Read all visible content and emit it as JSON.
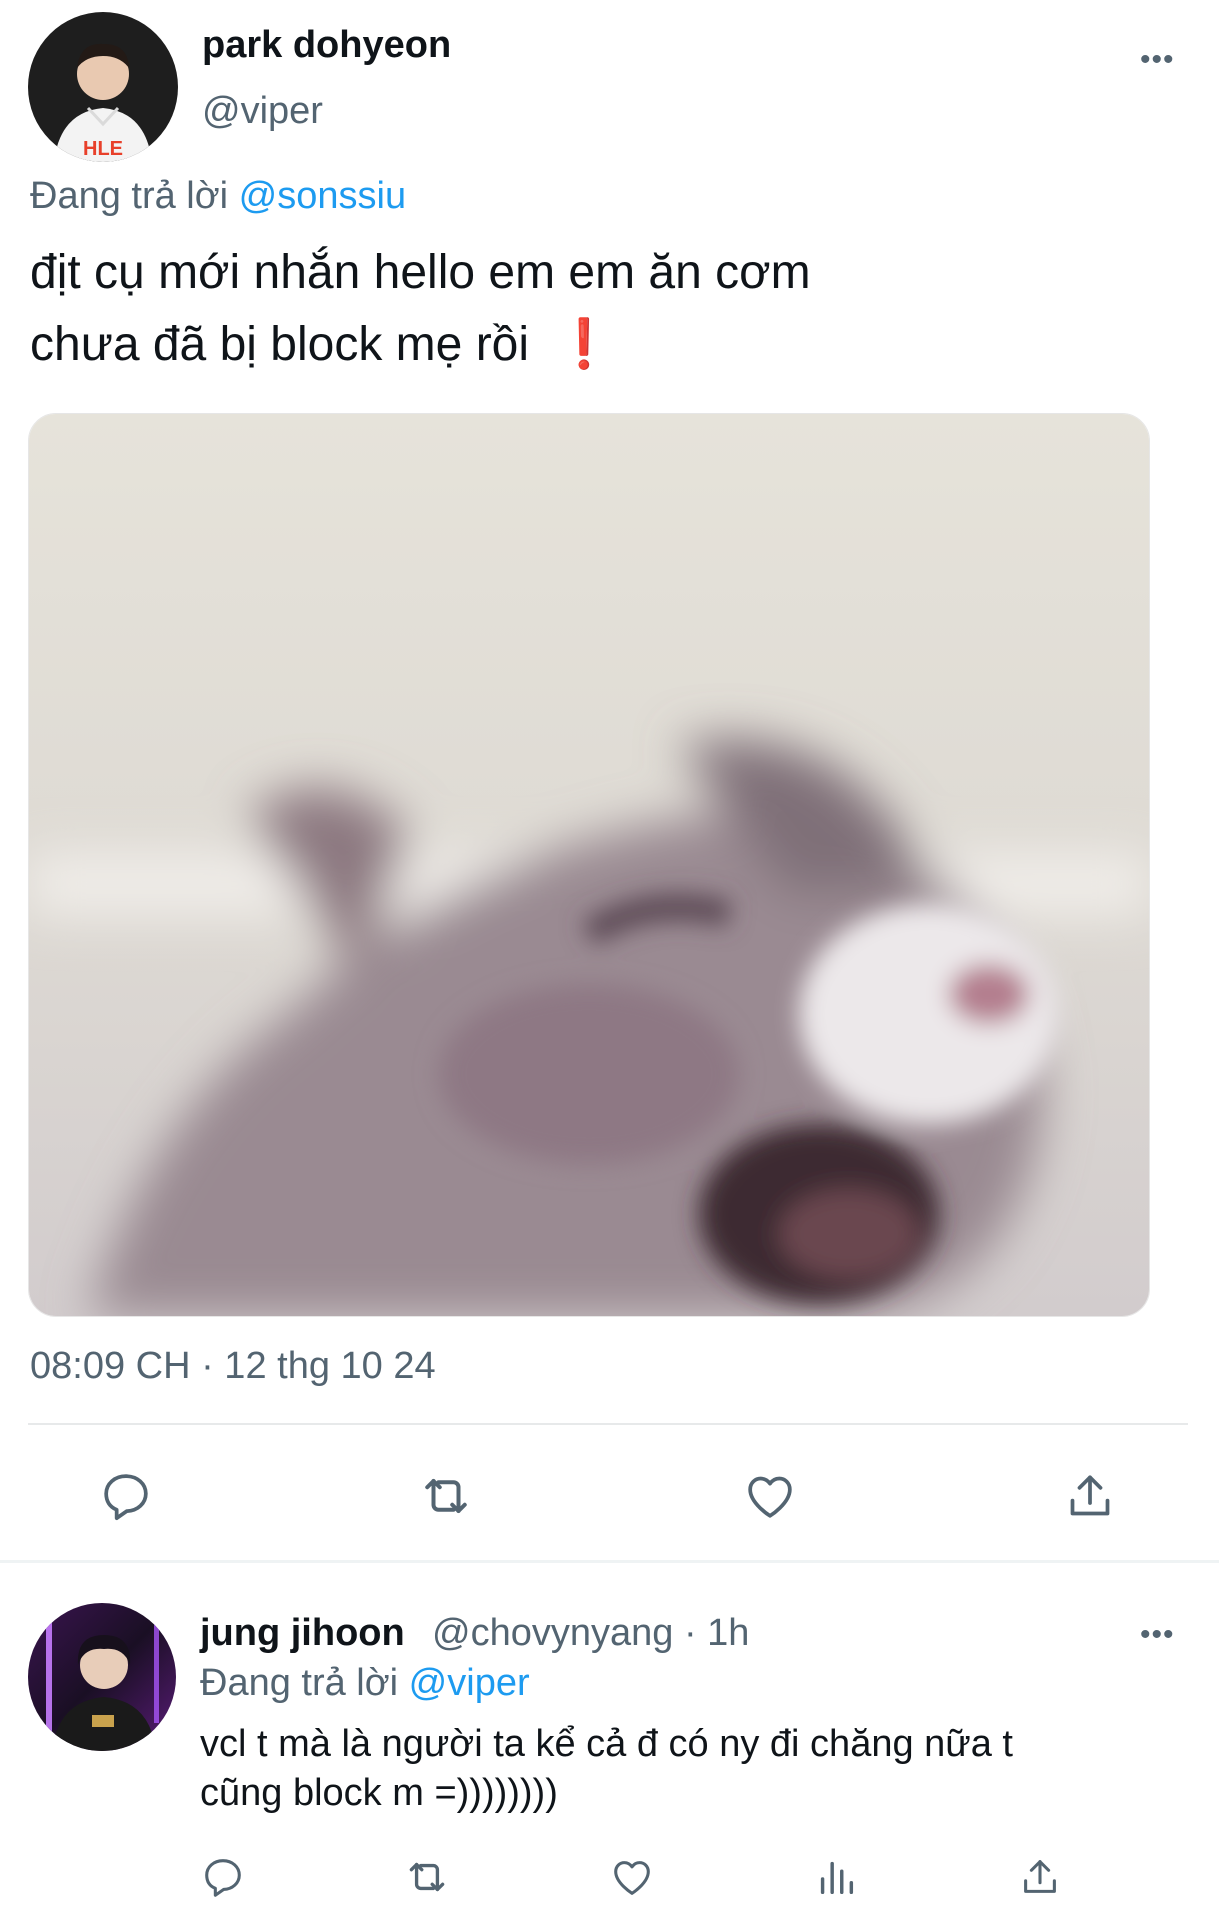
{
  "main_tweet": {
    "author_name": "park dohyeon",
    "author_handle": "@viper",
    "more_icon": "•••",
    "replying_prefix": "Đang trả lời ",
    "replying_to": "@sonssiu",
    "text_line1": "địt cụ mới nhắn hello em em ăn cơm",
    "text_line2": "chưa đã bị block mẹ rồi",
    "emoji": "❗",
    "avatar_badge": "HLE",
    "timestamp": "08:09 CH · 12 thg 10 24",
    "actions": [
      "reply-icon",
      "retweet-icon",
      "like-icon",
      "share-icon"
    ]
  },
  "reply_tweet": {
    "author_name": "jung jihoon",
    "author_handle": "@chovynyang",
    "time_ago": " · 1h",
    "more_icon": "•••",
    "replying_prefix": "Đang trả lời ",
    "replying_to": "@viper",
    "text_line1": "vcl t mà là người ta kể cả đ có ny đi chăng nữa t",
    "text_line2": "cũng block m =))))))))",
    "actions": [
      "reply-icon",
      "retweet-icon",
      "like-icon",
      "views-icon",
      "share-icon"
    ]
  },
  "colors": {
    "text": "#0f1419",
    "secondary": "#536471",
    "accent": "#1d9bf0",
    "divider": "#e7e9ea",
    "emoji_red": "#e0242a"
  }
}
